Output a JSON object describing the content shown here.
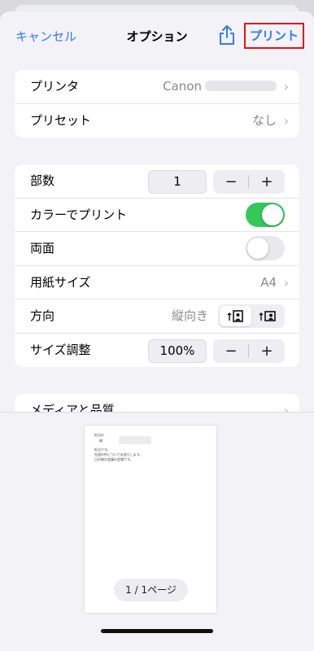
{
  "nav": {
    "cancel_label": "キャンセル",
    "title": "オプション",
    "print_label": "プリント"
  },
  "printer_group": {
    "printer_label": "プリンタ",
    "printer_value": "Canon",
    "preset_label": "プリセット",
    "preset_value": "なし"
  },
  "options_group": {
    "copies_label": "部数",
    "copies_value": "1",
    "minus": "−",
    "plus": "+",
    "color_label": "カラーでプリント",
    "color_on": true,
    "duplex_label": "両面",
    "duplex_on": false,
    "paper_label": "用紙サイズ",
    "paper_value": "A4",
    "orientation_label": "方向",
    "orientation_value": "縦向き",
    "scale_label": "サイズ調整",
    "scale_value": "100%"
  },
  "media_group": {
    "media_label": "メディアと品質"
  },
  "preview": {
    "line1": "担当の",
    "line2": "様",
    "line3": "担当です。",
    "line4": "先週の件についてお送りします。",
    "line5": "日の後の会議の会場です。",
    "page_indicator": "1 / 1ページ"
  },
  "colors": {
    "accent": "#2f7df6",
    "toggle_on": "#34c759",
    "highlight_box": "#e5121b"
  }
}
